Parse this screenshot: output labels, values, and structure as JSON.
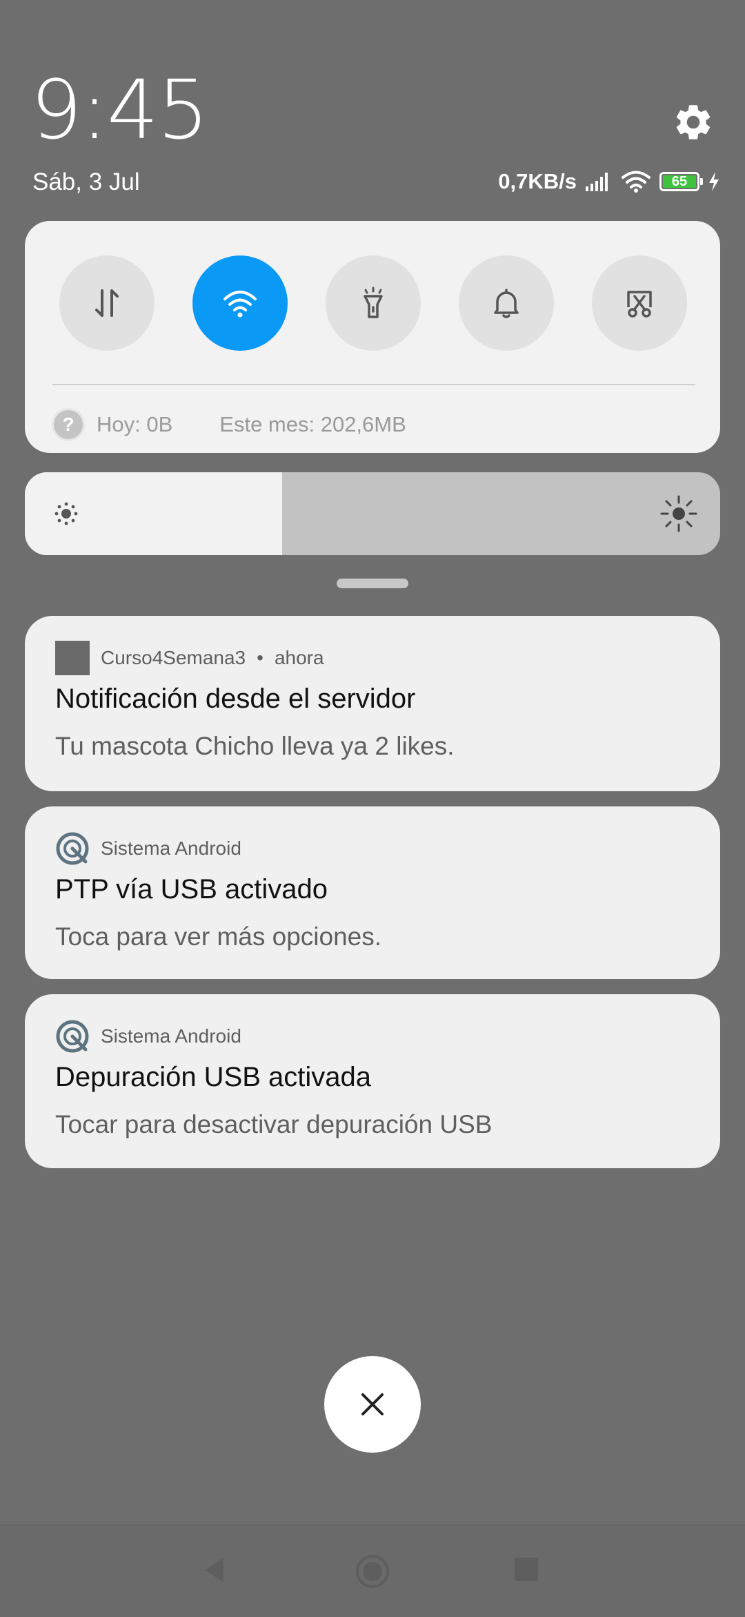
{
  "status_bar": {
    "time": "9:45",
    "date": "Sáb, 3 Jul",
    "net_speed": "0,7KB/s",
    "battery_level": "65",
    "icons": [
      "settings-icon",
      "signal-icon",
      "wifi-icon",
      "battery-icon",
      "charging-icon"
    ]
  },
  "quick_settings": {
    "tiles": [
      {
        "name": "mobile-data-icon",
        "active": false
      },
      {
        "name": "wifi-icon",
        "active": true
      },
      {
        "name": "flashlight-icon",
        "active": false
      },
      {
        "name": "bell-icon",
        "active": false
      },
      {
        "name": "screenshot-icon",
        "active": false
      }
    ],
    "data_today": "Hoy: 0B",
    "data_month": "Este mes: 202,6MB",
    "help_glyph": "?"
  },
  "brightness": {
    "level": 0.37
  },
  "notifications": [
    {
      "app": "Curso4Semana3",
      "separator": "•",
      "time": "ahora",
      "title": "Notificación desde el servidor",
      "text": "Tu mascota Chicho lleva ya 2 likes."
    },
    {
      "app": "Sistema Android",
      "title": "PTP vía USB activado",
      "text": "Toca para ver más opciones."
    },
    {
      "app": "Sistema Android",
      "title": "Depuración USB activada",
      "text": "Tocar para desactivar depuración USB"
    }
  ],
  "colors": {
    "background": "#6e6e6e",
    "panel": "#f2f2f2",
    "accent": "#0a99f5",
    "battery": "#3fc43f"
  },
  "close_button": {
    "icon": "close-icon"
  },
  "navigation": {
    "icons": [
      "back-icon",
      "home-icon",
      "recents-icon"
    ]
  }
}
